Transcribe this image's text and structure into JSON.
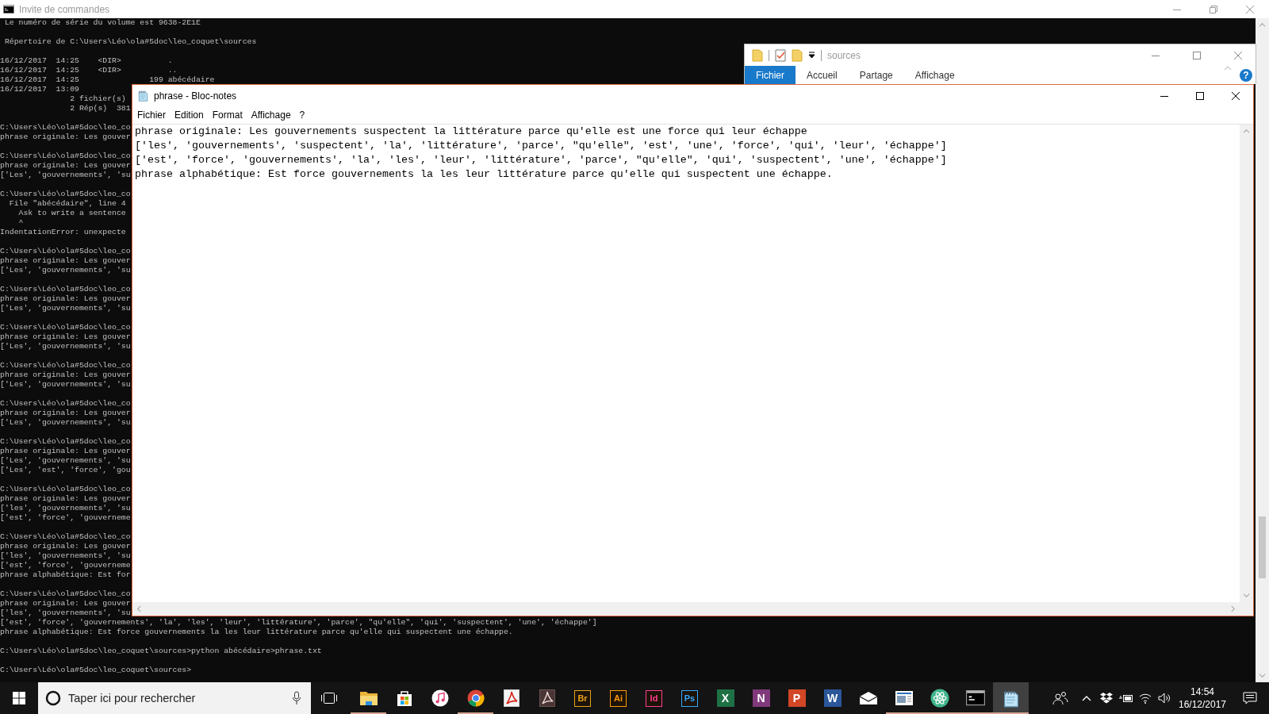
{
  "cmd_window": {
    "title": "Invite de commandes",
    "blocks": [
      [
        " Le numéro de série du volume est 9638-2E1E"
      ],
      [
        " Répertoire de C:\\Users\\Léo\\ola#5doc\\leo_coquet\\sources"
      ],
      [
        "16/12/2017  14:25    <DIR>          .",
        "16/12/2017  14:25    <DIR>          ..",
        "16/12/2017  14:25               199 abécédaire",
        "16/12/2017  13:09",
        "               2 fichier(s)",
        "               2 Rép(s)  381"
      ],
      [
        "C:\\Users\\Léo\\ola#5doc\\leo_co",
        "phrase originale: Les gouver"
      ],
      [
        "C:\\Users\\Léo\\ola#5doc\\leo_co",
        "phrase originale: Les gouver",
        "['Les', 'gouvernements', 'su"
      ],
      [
        "C:\\Users\\Léo\\ola#5doc\\leo_co",
        "  File \"abécédaire\", line 4",
        "    Ask to write a sentence",
        "    ^",
        "IndentationError: unexpecte"
      ],
      [
        "C:\\Users\\Léo\\ola#5doc\\leo_co",
        "phrase originale: Les gouver",
        "['Les', 'gouvernements', 'su"
      ],
      [
        "C:\\Users\\Léo\\ola#5doc\\leo_co",
        "phrase originale: Les gouver",
        "['Les', 'gouvernements', 'su"
      ],
      [
        "C:\\Users\\Léo\\ola#5doc\\leo_co",
        "phrase originale: Les gouver",
        "['Les', 'gouvernements', 'su"
      ],
      [
        "C:\\Users\\Léo\\ola#5doc\\leo_co",
        "phrase originale: Les gouver",
        "['Les', 'gouvernements', 'su"
      ],
      [
        "C:\\Users\\Léo\\ola#5doc\\leo_co",
        "phrase originale: Les gouver",
        "['Les', 'gouvernements', 'su"
      ],
      [
        "C:\\Users\\Léo\\ola#5doc\\leo_co",
        "phrase originale: Les gouver",
        "['Les', 'gouvernements', 'su",
        "['Les', 'est', 'force', 'gou"
      ],
      [
        "C:\\Users\\Léo\\ola#5doc\\leo_co",
        "phrase originale: Les gouver",
        "['les', 'gouvernements', 'su",
        "['est', 'force', 'gouverneme"
      ],
      [
        "C:\\Users\\Léo\\ola#5doc\\leo_co",
        "phrase originale: Les gouver",
        "['les', 'gouvernements', 'su",
        "['est', 'force', 'gouverneme",
        "phrase alphabétique: Est for"
      ],
      [
        "C:\\Users\\Léo\\ola#5doc\\leo_co",
        "phrase originale: Les gouver",
        "['les', 'gouvernements', 'su",
        "['est', 'force', 'gouvernements', 'la', 'les', 'leur', 'littérature', 'parce', \"qu'elle\", 'qui', 'suspectent', 'une', 'échappe']",
        "phrase alphabétique: Est force gouvernements la les leur littérature parce qu'elle qui suspectent une échappe."
      ],
      [
        "C:\\Users\\Léo\\ola#5doc\\leo_coquet\\sources>python abécédaire>phrase.txt"
      ],
      [
        "C:\\Users\\Léo\\ola#5doc\\leo_coquet\\sources>"
      ]
    ]
  },
  "explorer_window": {
    "title": "sources",
    "tabs": [
      {
        "label": "Fichier",
        "selected": true
      },
      {
        "label": "Accueil",
        "selected": false
      },
      {
        "label": "Partage",
        "selected": false
      },
      {
        "label": "Affichage",
        "selected": false
      }
    ],
    "help": "?"
  },
  "notepad_window": {
    "title": "phrase - Bloc-notes",
    "menu": [
      "Fichier",
      "Edition",
      "Format",
      "Affichage",
      "?"
    ],
    "lines": [
      "phrase originale: Les gouvernements suspectent la littérature parce qu'elle est une force qui leur échappe",
      "['les', 'gouvernements', 'suspectent', 'la', 'littérature', 'parce', \"qu'elle\", 'est', 'une', 'force', 'qui', 'leur', 'échappe']",
      "['est', 'force', 'gouvernements', 'la', 'les', 'leur', 'littérature', 'parce', \"qu'elle\", 'qui', 'suspectent', 'une', 'échappe']",
      "phrase alphabétique: Est force gouvernements la les leur littérature parce qu'elle qui suspectent une échappe."
    ]
  },
  "taskbar": {
    "search": {
      "placeholder": "Taper ici pour rechercher"
    },
    "apps": [
      {
        "kind": "folder",
        "running": true,
        "selected": false
      },
      {
        "kind": "store",
        "running": false,
        "selected": false
      },
      {
        "kind": "music",
        "running": false,
        "selected": false
      },
      {
        "kind": "browser",
        "running": true,
        "selected": false
      },
      {
        "kind": "pdf",
        "running": false,
        "selected": false
      },
      {
        "kind": "pdf-dark",
        "running": false,
        "selected": false
      },
      {
        "kind": "adobe",
        "label": "Br",
        "color": "#e8a317",
        "running": false,
        "selected": false
      },
      {
        "kind": "adobe",
        "label": "Ai",
        "color": "#ff9a00",
        "running": false,
        "selected": false
      },
      {
        "kind": "adobe",
        "label": "Id",
        "color": "#ff3f8e",
        "running": false,
        "selected": false
      },
      {
        "kind": "adobe",
        "label": "Ps",
        "color": "#31a8ff",
        "running": false,
        "selected": false
      },
      {
        "kind": "office",
        "label": "X",
        "color": "#1e7145",
        "running": false,
        "selected": false
      },
      {
        "kind": "office",
        "label": "N",
        "color": "#80397b",
        "running": false,
        "selected": false
      },
      {
        "kind": "office",
        "label": "P",
        "color": "#d24726",
        "running": false,
        "selected": false
      },
      {
        "kind": "office",
        "label": "W",
        "color": "#2b579a",
        "running": false,
        "selected": false
      },
      {
        "kind": "mail",
        "running": false,
        "selected": false
      },
      {
        "kind": "window",
        "running": true,
        "selected": false
      },
      {
        "kind": "atom",
        "running": true,
        "selected": false
      },
      {
        "kind": "terminal",
        "running": true,
        "selected": false
      },
      {
        "kind": "notepad",
        "running": true,
        "selected": true
      }
    ],
    "clock": {
      "time": "14:54",
      "date": "16/12/2017"
    }
  }
}
